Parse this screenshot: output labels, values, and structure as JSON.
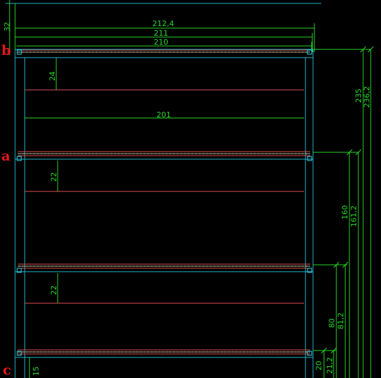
{
  "viewport": {
    "tool": "CAD drawing viewport"
  },
  "colors": {
    "background": "#000000",
    "frame": "#20b8d0",
    "dimension": "#29d629",
    "shelf_edge": "#e05050",
    "shelf_board": "#c9b99a",
    "label": "#e01818",
    "grip": "#2fd8f0"
  },
  "labels": {
    "a": "a",
    "b": "b",
    "c": "c"
  },
  "dimensions": {
    "top_margin": "32",
    "overall_width": "212,4",
    "outer_width": "211",
    "inner_width": "210",
    "shelf_span": "201",
    "top_shelf_depth": "24",
    "mid_shelf_depth": "22",
    "low_shelf_depth": "22",
    "bottom_left": "15",
    "height_b_inner": "235",
    "height_b_outer": "236,2",
    "height_a_inner": "160",
    "height_a_outer": "161,2",
    "height_low_inner": "80",
    "height_low_outer": "81,2",
    "height_c_inner": "20",
    "height_c_outer": "21,2"
  }
}
